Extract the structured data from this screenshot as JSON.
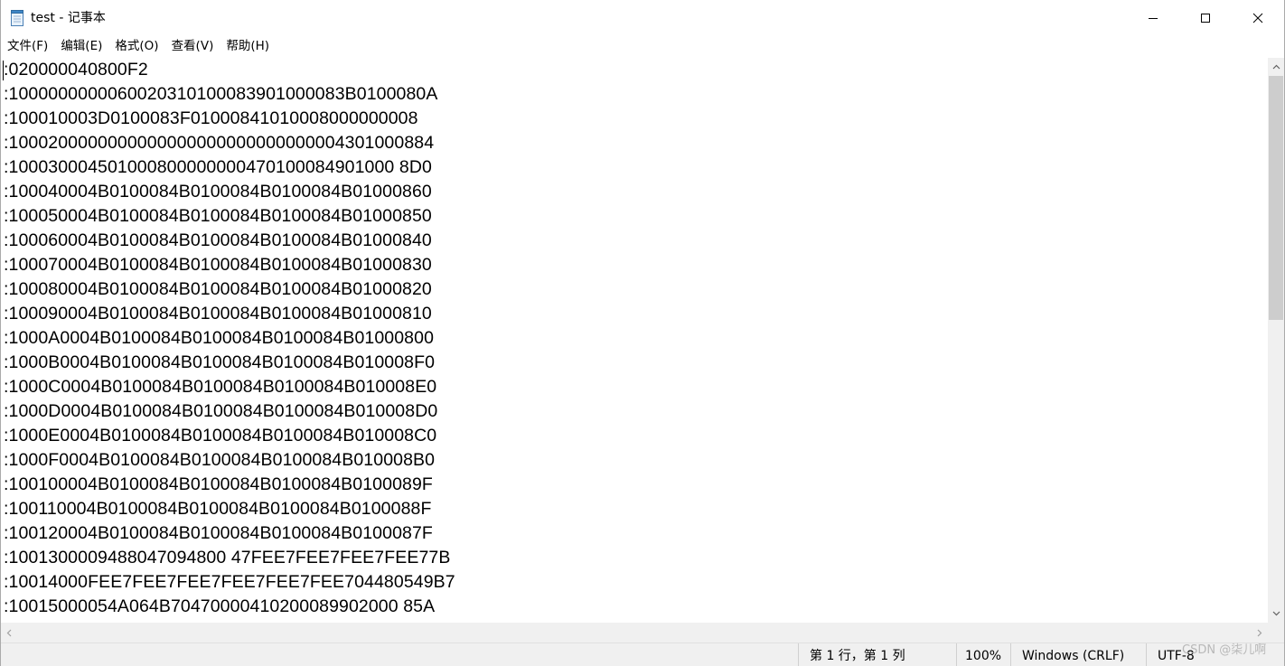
{
  "window": {
    "title": "test - 记事本",
    "controls": {
      "minimize_icon": "minimize-icon",
      "maximize_icon": "maximize-icon",
      "close_icon": "close-icon"
    }
  },
  "menu": [
    {
      "label": "文件(F)"
    },
    {
      "label": "编辑(E)"
    },
    {
      "label": "格式(O)"
    },
    {
      "label": "查看(V)"
    },
    {
      "label": "帮助(H)"
    }
  ],
  "editor": {
    "lines": [
      ":020000040800F2",
      ":1000000000060020310100083901000083B0100080A",
      ":100010003D0100083F01000841010008000000008",
      ":1000200000000000000000000000000004301000884",
      ":100030004501000800000000470100084901000 8D0",
      ":100040004B0100084B0100084B0100084B01000860",
      ":100050004B0100084B0100084B0100084B01000850",
      ":100060004B0100084B0100084B0100084B01000840",
      ":100070004B0100084B0100084B0100084B01000830",
      ":100080004B0100084B0100084B0100084B01000820",
      ":100090004B0100084B0100084B0100084B01000810",
      ":1000A0004B0100084B0100084B0100084B01000800",
      ":1000B0004B0100084B0100084B0100084B010008F0",
      ":1000C0004B0100084B0100084B0100084B010008E0",
      ":1000D0004B0100084B0100084B0100084B010008D0",
      ":1000E0004B0100084B0100084B0100084B010008C0",
      ":1000F0004B0100084B0100084B0100084B010008B0",
      ":100100004B0100084B0100084B0100084B0100089F",
      ":100110004B0100084B0100084B0100084B0100088F",
      ":100120004B0100084B0100084B0100084B0100087F",
      ":1001300009488047094800 47FEE7FEE7FEE7FEE77B",
      ":10014000FEE7FEE7FEE7FEE7FEE7FEE704480549B7",
      ":10015000054A064B70470000410200089902000 85A"
    ]
  },
  "scrollbars": {
    "vertical": {
      "scroll_fraction": 0.0
    },
    "horizontal": {
      "scroll_fraction": 0.0
    }
  },
  "status": {
    "position": "第 1 行，第 1 列",
    "zoom": "100%",
    "line_ending": "Windows (CRLF)",
    "encoding": "UTF-8"
  },
  "watermark": "CSDN @柒儿啊"
}
